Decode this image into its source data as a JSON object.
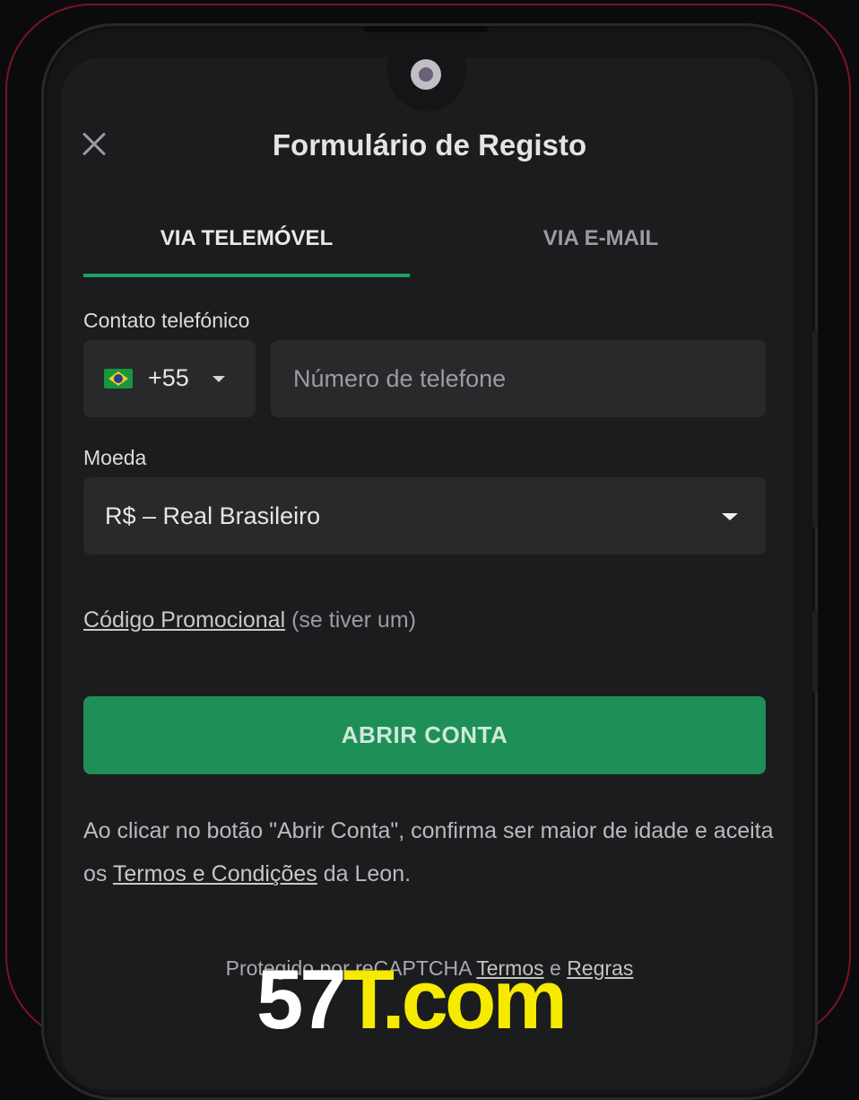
{
  "header": {
    "title": "Formulário de Registo"
  },
  "tabs": [
    {
      "label": "VIA TELEMÓVEL",
      "active": true
    },
    {
      "label": "VIA E-MAIL",
      "active": false
    }
  ],
  "phone_field": {
    "label": "Contato telefónico",
    "country_code": "+55",
    "flag_icon": "brazil-flag-icon",
    "placeholder": "Número de telefone",
    "value": ""
  },
  "currency_field": {
    "label": "Moeda",
    "value": "R$ – Real Brasileiro"
  },
  "promo": {
    "link_label": "Código Promocional",
    "suffix": "(se tiver um)"
  },
  "submit": {
    "label": "ABRIR CONTA"
  },
  "disclaimer": {
    "before": "Ao clicar no botão \"Abrir Conta\", confirma ser maior de idade e aceita os ",
    "terms_link": "Termos e Condições",
    "after": " da Leon."
  },
  "recaptcha": {
    "prefix": "Protegido por reCAPTCHA",
    "terms_link": "Termos",
    "conjunction": "e",
    "rules_link": "Regras"
  },
  "watermark": {
    "part1": "57",
    "part2": "T.com"
  },
  "colors": {
    "accent_green": "#21a065",
    "button_green": "#1e8f57",
    "frame_red": "#7a1422",
    "watermark_yellow": "#f6ea00"
  }
}
